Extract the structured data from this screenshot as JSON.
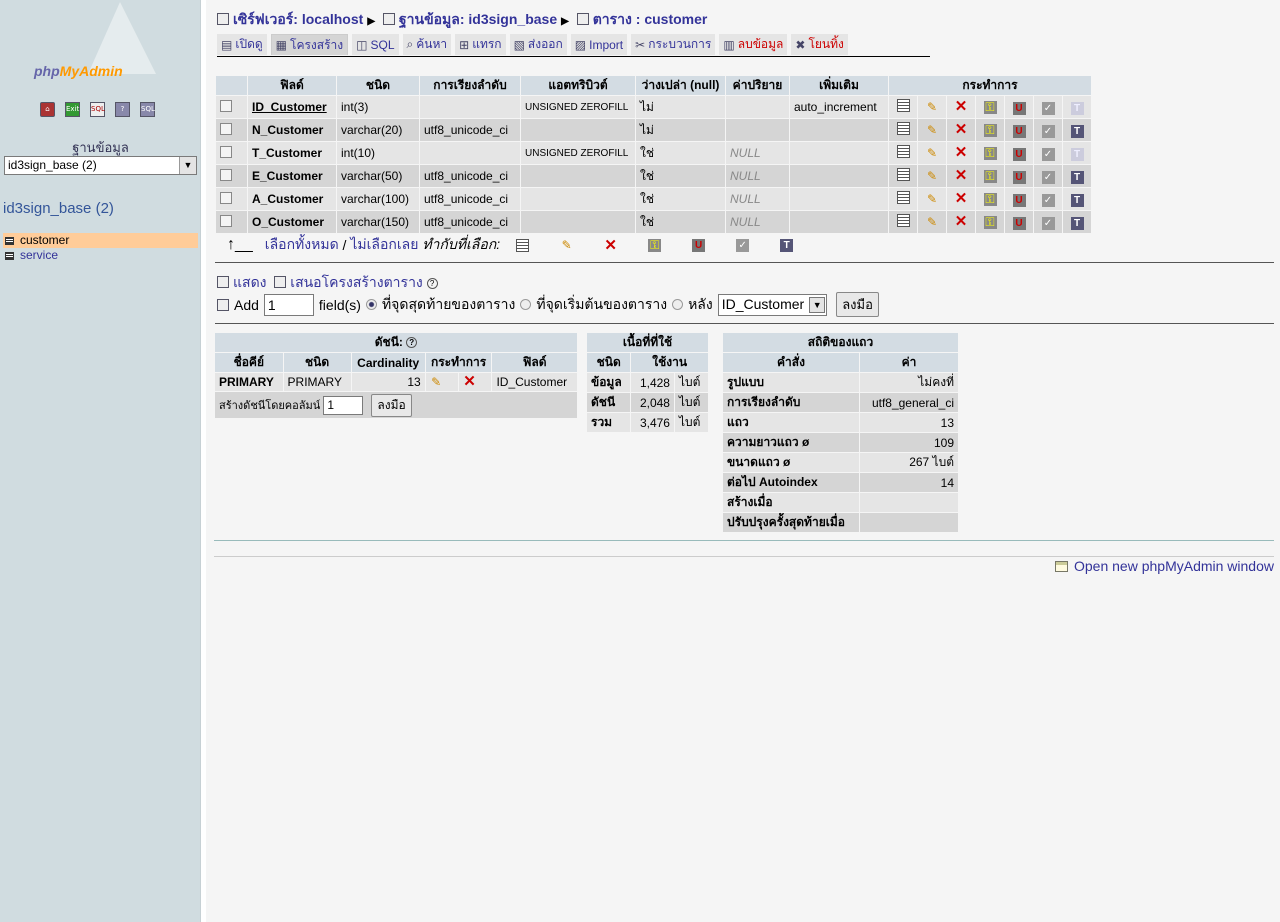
{
  "sidebar": {
    "logo": {
      "part1": "php",
      "part2": "MyAdmin"
    },
    "icons": [
      "home-icon",
      "exit-icon",
      "sql-query-icon",
      "help-icon",
      "sql-docs-icon"
    ],
    "database_label": "ฐานข้อมูล",
    "database_select": "id3sign_base (2)",
    "database_name": "id3sign_base (2)",
    "tables": [
      {
        "label": "customer",
        "active": true
      },
      {
        "label": "service",
        "active": false
      }
    ]
  },
  "breadcrumb": {
    "server": "เซิร์ฟเวอร์: localhost",
    "database": "ฐานข้อมูล: id3sign_base",
    "table": "ตาราง : customer"
  },
  "tabs": [
    {
      "label": "เปิดดู",
      "icon": "browse-icon"
    },
    {
      "label": "โครงสร้าง",
      "icon": "structure-icon",
      "active": true
    },
    {
      "label": "SQL",
      "icon": "sql-icon"
    },
    {
      "label": "ค้นหา",
      "icon": "search-icon"
    },
    {
      "label": "แทรก",
      "icon": "insert-icon"
    },
    {
      "label": "ส่งออก",
      "icon": "export-icon"
    },
    {
      "label": "Import",
      "icon": "import-icon"
    },
    {
      "label": "กระบวนการ",
      "icon": "operations-icon"
    },
    {
      "label": "ลบข้อมูล",
      "icon": "empty-icon",
      "danger": true
    },
    {
      "label": "โยนทิ้ง",
      "icon": "drop-icon",
      "danger": true
    }
  ],
  "structure": {
    "headers": [
      "ฟิลด์",
      "ชนิด",
      "การเรียงลำดับ",
      "แอตทริบิวต์",
      "ว่างเปล่า (null)",
      "ค่าปริยาย",
      "เพิ่มเติม",
      "กระทำการ"
    ],
    "rows": [
      {
        "field": "ID_Customer",
        "type": "int(3)",
        "collation": "",
        "attributes": "UNSIGNED ZEROFILL",
        "null": "ไม่",
        "default": "",
        "extra": "auto_increment",
        "primary": true,
        "fulltext_enabled": false
      },
      {
        "field": "N_Customer",
        "type": "varchar(20)",
        "collation": "utf8_unicode_ci",
        "attributes": "",
        "null": "ไม่",
        "default": "",
        "extra": "",
        "fulltext_enabled": true
      },
      {
        "field": "T_Customer",
        "type": "int(10)",
        "collation": "",
        "attributes": "UNSIGNED ZEROFILL",
        "null": "ใช่",
        "default": "NULL",
        "extra": "",
        "fulltext_enabled": false
      },
      {
        "field": "E_Customer",
        "type": "varchar(50)",
        "collation": "utf8_unicode_ci",
        "attributes": "",
        "null": "ใช่",
        "default": "NULL",
        "extra": "",
        "fulltext_enabled": true
      },
      {
        "field": "A_Customer",
        "type": "varchar(100)",
        "collation": "utf8_unicode_ci",
        "attributes": "",
        "null": "ใช่",
        "default": "NULL",
        "extra": "",
        "fulltext_enabled": true
      },
      {
        "field": "O_Customer",
        "type": "varchar(150)",
        "collation": "utf8_unicode_ci",
        "attributes": "",
        "null": "ใช่",
        "default": "NULL",
        "extra": "",
        "fulltext_enabled": true
      }
    ],
    "row_actions": [
      "browse-distinct-icon",
      "edit-icon",
      "delete-icon",
      "primary-key-icon",
      "unique-icon",
      "index-icon",
      "fulltext-icon"
    ],
    "check_all": "เลือกทั้งหมด",
    "uncheck_all": "ไม่เลือกเลย",
    "with_selected": "ทำกับที่เลือก:"
  },
  "links": {
    "print": "แสดง",
    "propose": "เสนอโครงสร้างตาราง"
  },
  "add_field": {
    "label": "Add",
    "count": "1",
    "suffix": "field(s)",
    "options": [
      "ที่จุดสุดท้ายของตาราง",
      "ที่จุดเริ่มต้นของตาราง",
      "หลัง"
    ],
    "selected_option": 0,
    "after_field": "ID_Customer",
    "go": "ลงมือ"
  },
  "indexes": {
    "title": "ดัชนี:",
    "headers": [
      "ชื่อคีย์",
      "ชนิด",
      "Cardinality",
      "กระทำการ",
      "ฟิลด์"
    ],
    "rows": [
      {
        "key": "PRIMARY",
        "type": "PRIMARY",
        "cardinality": "13",
        "field": "ID_Customer"
      }
    ],
    "create_label": "สร้างดัชนีโดยคอลัมน์",
    "create_count": "1",
    "go": "ลงมือ"
  },
  "space": {
    "title": "เนื้อที่ที่ใช้",
    "headers": [
      "ชนิด",
      "ใช้งาน"
    ],
    "rows": [
      {
        "type": "ข้อมูล",
        "value": "1,428",
        "unit": "ไบต์"
      },
      {
        "type": "ดัชนี",
        "value": "2,048",
        "unit": "ไบต์"
      },
      {
        "type": "รวม",
        "value": "3,476",
        "unit": "ไบต์"
      }
    ]
  },
  "row_stats": {
    "title": "สถิติของแถว",
    "headers": [
      "คำสั่ง",
      "ค่า"
    ],
    "rows": [
      {
        "name": "รูปแบบ",
        "value": "ไม่คงที่"
      },
      {
        "name": "การเรียงลำดับ",
        "value": "utf8_general_ci"
      },
      {
        "name": "แถว",
        "value": "13"
      },
      {
        "name": "ความยาวแถว ø",
        "value": "109"
      },
      {
        "name": "ขนาดแถว ø",
        "value": "267 ไบต์"
      },
      {
        "name": "ต่อไป Autoindex",
        "value": "14"
      },
      {
        "name": "สร้างเมื่อ",
        "value": ""
      },
      {
        "name": "ปรับปรุงครั้งสุดท้ายเมื่อ",
        "value": ""
      }
    ]
  },
  "footer": {
    "new_window": "Open new phpMyAdmin window"
  }
}
